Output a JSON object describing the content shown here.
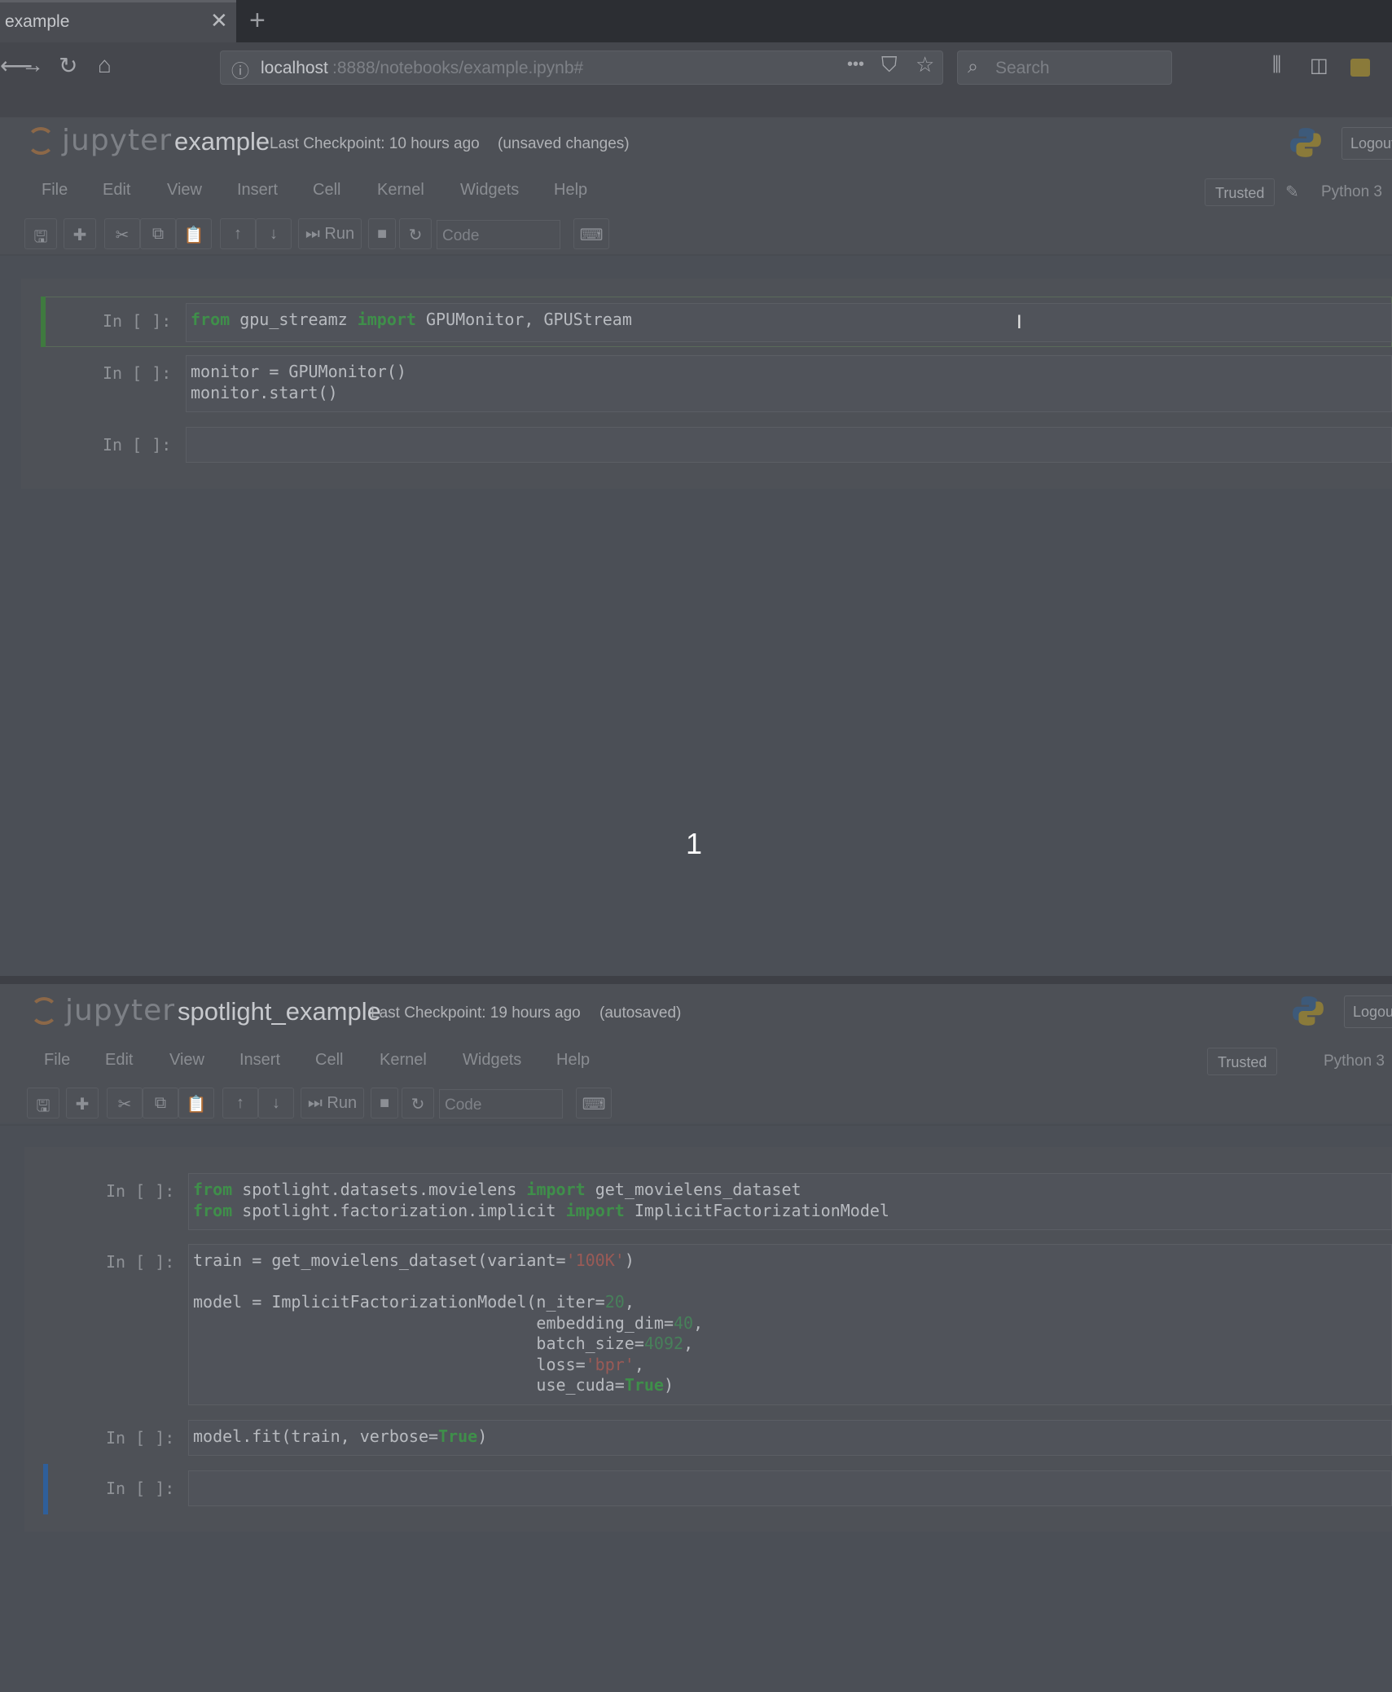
{
  "browser": {
    "tab_title": "example",
    "tab_close": "✕",
    "new_tab": "+",
    "url_host": "localhost",
    "url_path": ":8888/notebooks/example.ipynb#",
    "search_placeholder": "Search",
    "url_more": "•••"
  },
  "notebook_top": {
    "logo_text": "jupyter",
    "title": "example",
    "checkpoint": "Last Checkpoint: 10 hours ago",
    "save_status": "(unsaved changes)",
    "logout": "Logout",
    "menu": [
      "File",
      "Edit",
      "View",
      "Insert",
      "Cell",
      "Kernel",
      "Widgets",
      "Help"
    ],
    "trusted": "Trusted",
    "kernel": "Python 3",
    "run_label": "Run",
    "cell_type": "Code",
    "cells": [
      {
        "prompt": "In [ ]:",
        "lines": [
          [
            [
              "kw",
              "from"
            ],
            [
              "",
              " gpu_streamz "
            ],
            [
              "kw",
              "import"
            ],
            [
              "",
              " GPUMonitor, GPUStream"
            ]
          ]
        ]
      },
      {
        "prompt": "In [ ]:",
        "lines": [
          [
            [
              "",
              "monitor = GPUMonitor()"
            ]
          ],
          [
            [
              "",
              "monitor.start()"
            ]
          ]
        ]
      },
      {
        "prompt": "In [ ]:",
        "lines": [
          [
            [
              "",
              ""
            ]
          ]
        ]
      }
    ]
  },
  "page_number": "1",
  "notebook_bottom": {
    "logo_text": "jupyter",
    "title": "spotlight_example",
    "checkpoint": "Last Checkpoint: 19 hours ago",
    "save_status": "(autosaved)",
    "logout": "Logout",
    "menu": [
      "File",
      "Edit",
      "View",
      "Insert",
      "Cell",
      "Kernel",
      "Widgets",
      "Help"
    ],
    "trusted": "Trusted",
    "kernel": "Python 3",
    "run_label": "Run",
    "cell_type": "Code",
    "cells": [
      {
        "prompt": "In [ ]:",
        "lines": [
          [
            [
              "kw",
              "from"
            ],
            [
              "",
              " spotlight.datasets.movielens "
            ],
            [
              "kw",
              "import"
            ],
            [
              "",
              " get_movielens_dataset"
            ]
          ],
          [
            [
              "kw",
              "from"
            ],
            [
              "",
              " spotlight.factorization.implicit "
            ],
            [
              "kw",
              "import"
            ],
            [
              "",
              " ImplicitFactorizationModel"
            ]
          ]
        ]
      },
      {
        "prompt": "In [ ]:",
        "lines": [
          [
            [
              "",
              "train = get_movielens_dataset(variant="
            ],
            [
              "str",
              "'100K'"
            ],
            [
              "",
              ")"
            ]
          ],
          [
            [
              "",
              ""
            ]
          ],
          [
            [
              "",
              "model = ImplicitFactorizationModel(n_iter="
            ],
            [
              "num",
              "20"
            ],
            [
              "",
              ","
            ]
          ],
          [
            [
              "",
              "                                   embedding_dim="
            ],
            [
              "num",
              "40"
            ],
            [
              "",
              ","
            ]
          ],
          [
            [
              "",
              "                                   batch_size="
            ],
            [
              "num",
              "4092"
            ],
            [
              "",
              ","
            ]
          ],
          [
            [
              "",
              "                                   loss="
            ],
            [
              "str",
              "'bpr'"
            ],
            [
              "",
              ","
            ]
          ],
          [
            [
              "",
              "                                   use_cuda="
            ],
            [
              "kw",
              "True"
            ],
            [
              "",
              ")"
            ]
          ]
        ]
      },
      {
        "prompt": "In [ ]:",
        "lines": [
          [
            [
              "",
              "model.fit(train, verbose="
            ],
            [
              "kw",
              "True"
            ],
            [
              "",
              ")"
            ]
          ]
        ]
      },
      {
        "prompt": "In [ ]:",
        "lines": [
          [
            [
              "",
              ""
            ]
          ]
        ]
      }
    ]
  },
  "colors": {
    "page_bg": "#4b4f56",
    "keyword": "#3f8f4a",
    "number": "#47805a",
    "string": "#9a5a56",
    "selected_cell_top": "#3f7a3f",
    "selected_cell_bottom": "#2f5f9a"
  }
}
